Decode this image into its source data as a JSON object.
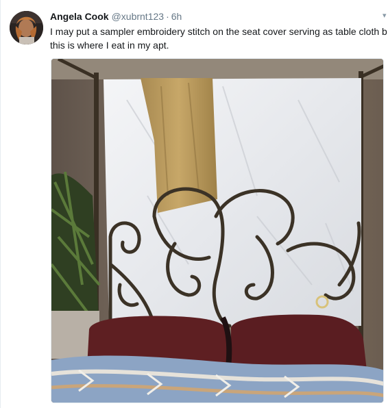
{
  "author": {
    "name": "Angela Cook",
    "handle": "@xubrnt123",
    "separator": "·",
    "time": "6h"
  },
  "tweet": {
    "line1": "I may put a sampler embroidery stitch on the seat cover serving as table cloth b",
    "line2": "this is where I eat in my apt."
  },
  "icons": {
    "caret": "chevron-down-icon"
  },
  "colors": {
    "name": "#14171a",
    "meta": "#657786",
    "text": "#14171a",
    "border": "#e1e8ed"
  }
}
